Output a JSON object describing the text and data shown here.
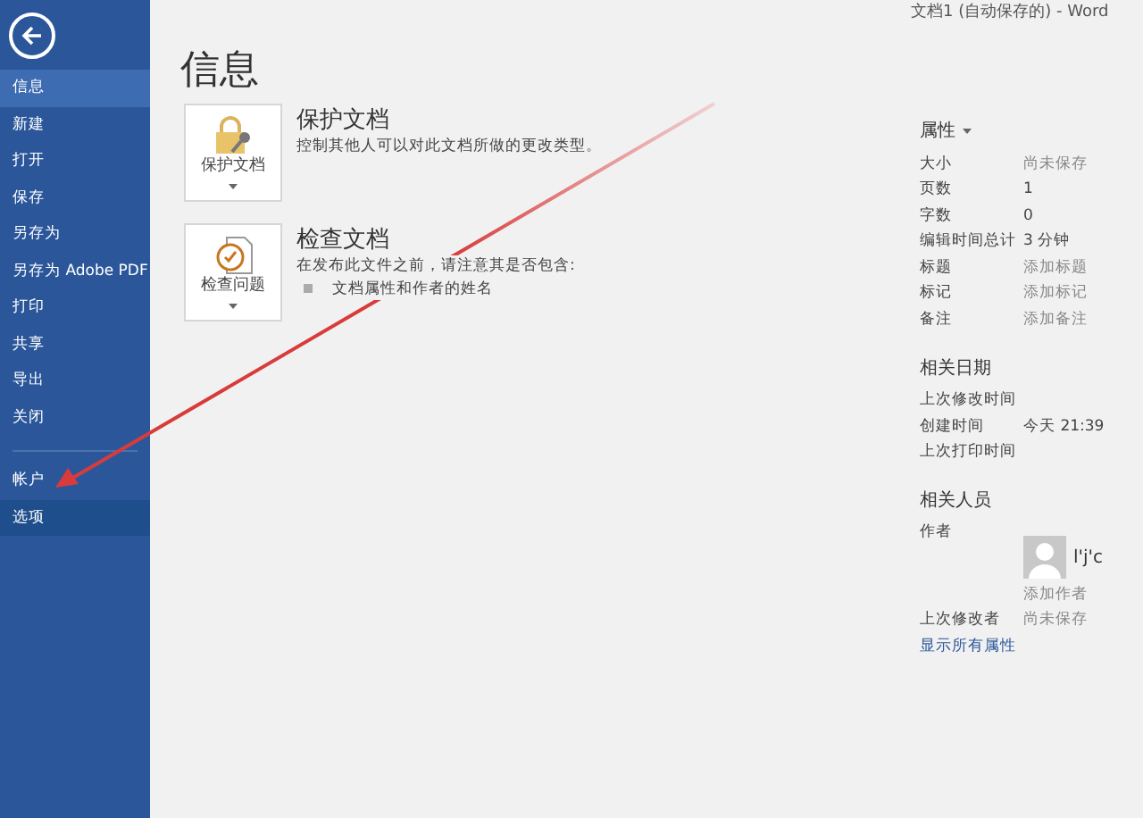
{
  "window": {
    "title": "文档1 (自动保存的) - Word"
  },
  "sidebar": {
    "items": [
      {
        "label": "信息",
        "selected": true
      },
      {
        "label": "新建",
        "selected": false
      },
      {
        "label": "打开",
        "selected": false
      },
      {
        "label": "保存",
        "selected": false
      },
      {
        "label": "另存为",
        "selected": false
      },
      {
        "label": "另存为 Adobe PDF",
        "selected": false
      },
      {
        "label": "打印",
        "selected": false
      },
      {
        "label": "共享",
        "selected": false
      },
      {
        "label": "导出",
        "selected": false
      },
      {
        "label": "关闭",
        "selected": false
      }
    ],
    "bottom_items": [
      {
        "label": "帐户",
        "selected": false
      },
      {
        "label": "选项",
        "selected": false
      }
    ]
  },
  "page_title": "信息",
  "sections": [
    {
      "kind": "protect",
      "button_label": "保护文档",
      "title": "保护文档",
      "description": "控制其他人可以对此文档所做的更改类型。"
    },
    {
      "kind": "inspect",
      "button_label": "检查问题",
      "title": "检查文档",
      "description": "在发布此文件之前，请注意其是否包含:",
      "bullets": [
        "文档属性和作者的姓名"
      ]
    }
  ],
  "properties": {
    "heading": "属性",
    "rows": [
      {
        "label": "大小",
        "value": "尚未保存",
        "muted": true
      },
      {
        "label": "页数",
        "value": "1",
        "muted": false
      },
      {
        "label": "字数",
        "value": "0",
        "muted": false
      },
      {
        "label": "编辑时间总计",
        "value": "3 分钟",
        "muted": false
      },
      {
        "label": "标题",
        "value": "添加标题",
        "muted": true
      },
      {
        "label": "标记",
        "value": "添加标记",
        "muted": true
      },
      {
        "label": "备注",
        "value": "添加备注",
        "muted": true
      }
    ]
  },
  "related_dates": {
    "heading": "相关日期",
    "rows": [
      {
        "label": "上次修改时间"
      },
      {
        "label": "创建时间",
        "value": "今天 21:39"
      },
      {
        "label": "上次打印时间"
      }
    ]
  },
  "related_people": {
    "heading": "相关人员",
    "author_label": "作者",
    "author_name": "l'j'c",
    "add_author": "添加作者",
    "last_modified_label": "上次修改者",
    "last_modified_value": "尚未保存"
  },
  "show_all_link": "显示所有属性"
}
